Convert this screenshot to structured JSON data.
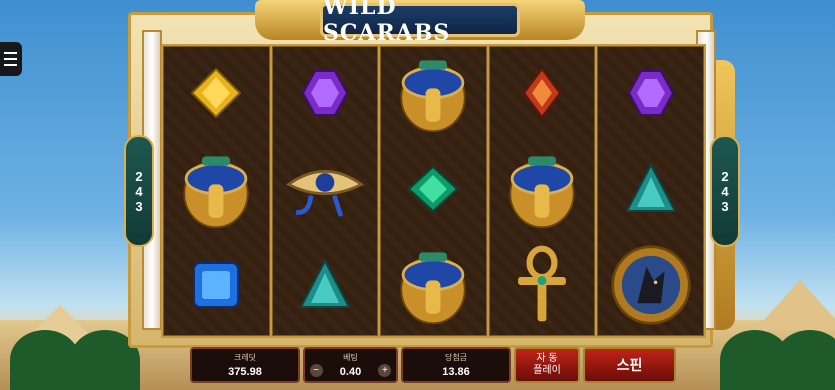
{
  "game": {
    "title": "WILD SCARABS",
    "ways_left": [
      "2",
      "4",
      "3"
    ],
    "ways_right": [
      "2",
      "4",
      "3"
    ]
  },
  "reels": [
    [
      "gem-yellow",
      "scarab",
      "gem-blue"
    ],
    [
      "gem-purple",
      "eye-of-horus",
      "gem-teal"
    ],
    [
      "scarab",
      "gem-green",
      "scarab"
    ],
    [
      "gem-red",
      "scarab",
      "ankh"
    ],
    [
      "gem-purple",
      "gem-teal",
      "anubis-coin"
    ]
  ],
  "controls": {
    "credit_label": "크레딧",
    "credit_value": "375.98",
    "bet_label": "베팅",
    "bet_value": "0.40",
    "bet_minus": "−",
    "bet_plus": "+",
    "win_label": "당첨금",
    "win_value": "13.86",
    "autoplay_line1": "자 동",
    "autoplay_line2": "플레이",
    "spin_label": "스핀"
  },
  "colors": {
    "accent": "#c02418",
    "gold": "#d8b04f",
    "panel": "#1b0d0a"
  }
}
